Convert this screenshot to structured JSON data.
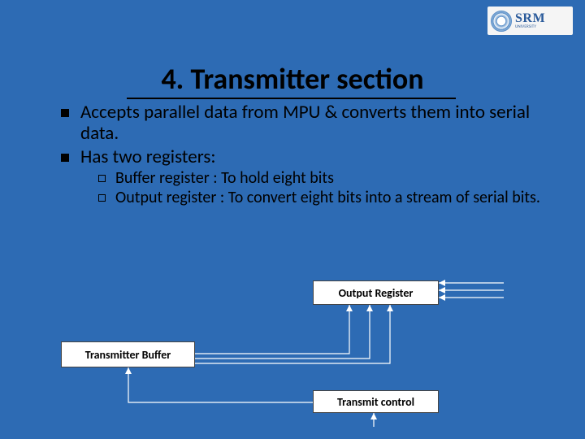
{
  "logo": {
    "name": "SRM",
    "sub": "UNIVERSITY"
  },
  "title": "4. Transmitter section",
  "bullets": {
    "b1": "Accepts parallel data from MPU & converts them into serial data.",
    "b2": "Has two registers:",
    "s1": "Buffer register : To hold eight bits",
    "s2": "Output register : To convert eight bits into a stream of serial bits."
  },
  "diagram": {
    "output": "Output Register",
    "buffer": "Transmitter Buffer",
    "control": "Transmit control"
  }
}
